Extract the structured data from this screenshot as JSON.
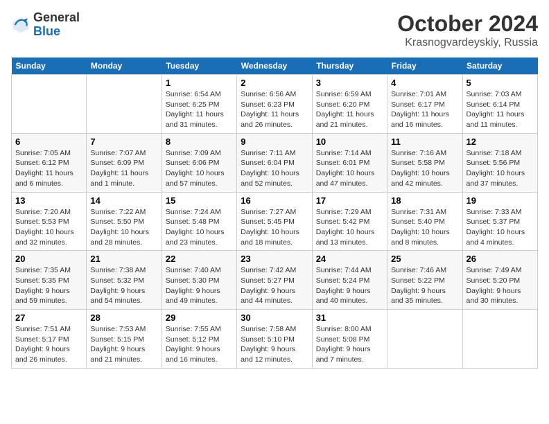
{
  "header": {
    "logo_line1": "General",
    "logo_line2": "Blue",
    "month": "October 2024",
    "location": "Krasnogvardeyskiy, Russia"
  },
  "weekdays": [
    "Sunday",
    "Monday",
    "Tuesday",
    "Wednesday",
    "Thursday",
    "Friday",
    "Saturday"
  ],
  "weeks": [
    [
      {
        "day": "",
        "info": ""
      },
      {
        "day": "",
        "info": ""
      },
      {
        "day": "1",
        "info": "Sunrise: 6:54 AM\nSunset: 6:25 PM\nDaylight: 11 hours\nand 31 minutes."
      },
      {
        "day": "2",
        "info": "Sunrise: 6:56 AM\nSunset: 6:23 PM\nDaylight: 11 hours\nand 26 minutes."
      },
      {
        "day": "3",
        "info": "Sunrise: 6:59 AM\nSunset: 6:20 PM\nDaylight: 11 hours\nand 21 minutes."
      },
      {
        "day": "4",
        "info": "Sunrise: 7:01 AM\nSunset: 6:17 PM\nDaylight: 11 hours\nand 16 minutes."
      },
      {
        "day": "5",
        "info": "Sunrise: 7:03 AM\nSunset: 6:14 PM\nDaylight: 11 hours\nand 11 minutes."
      }
    ],
    [
      {
        "day": "6",
        "info": "Sunrise: 7:05 AM\nSunset: 6:12 PM\nDaylight: 11 hours\nand 6 minutes."
      },
      {
        "day": "7",
        "info": "Sunrise: 7:07 AM\nSunset: 6:09 PM\nDaylight: 11 hours\nand 1 minute."
      },
      {
        "day": "8",
        "info": "Sunrise: 7:09 AM\nSunset: 6:06 PM\nDaylight: 10 hours\nand 57 minutes."
      },
      {
        "day": "9",
        "info": "Sunrise: 7:11 AM\nSunset: 6:04 PM\nDaylight: 10 hours\nand 52 minutes."
      },
      {
        "day": "10",
        "info": "Sunrise: 7:14 AM\nSunset: 6:01 PM\nDaylight: 10 hours\nand 47 minutes."
      },
      {
        "day": "11",
        "info": "Sunrise: 7:16 AM\nSunset: 5:58 PM\nDaylight: 10 hours\nand 42 minutes."
      },
      {
        "day": "12",
        "info": "Sunrise: 7:18 AM\nSunset: 5:56 PM\nDaylight: 10 hours\nand 37 minutes."
      }
    ],
    [
      {
        "day": "13",
        "info": "Sunrise: 7:20 AM\nSunset: 5:53 PM\nDaylight: 10 hours\nand 32 minutes."
      },
      {
        "day": "14",
        "info": "Sunrise: 7:22 AM\nSunset: 5:50 PM\nDaylight: 10 hours\nand 28 minutes."
      },
      {
        "day": "15",
        "info": "Sunrise: 7:24 AM\nSunset: 5:48 PM\nDaylight: 10 hours\nand 23 minutes."
      },
      {
        "day": "16",
        "info": "Sunrise: 7:27 AM\nSunset: 5:45 PM\nDaylight: 10 hours\nand 18 minutes."
      },
      {
        "day": "17",
        "info": "Sunrise: 7:29 AM\nSunset: 5:42 PM\nDaylight: 10 hours\nand 13 minutes."
      },
      {
        "day": "18",
        "info": "Sunrise: 7:31 AM\nSunset: 5:40 PM\nDaylight: 10 hours\nand 8 minutes."
      },
      {
        "day": "19",
        "info": "Sunrise: 7:33 AM\nSunset: 5:37 PM\nDaylight: 10 hours\nand 4 minutes."
      }
    ],
    [
      {
        "day": "20",
        "info": "Sunrise: 7:35 AM\nSunset: 5:35 PM\nDaylight: 9 hours\nand 59 minutes."
      },
      {
        "day": "21",
        "info": "Sunrise: 7:38 AM\nSunset: 5:32 PM\nDaylight: 9 hours\nand 54 minutes."
      },
      {
        "day": "22",
        "info": "Sunrise: 7:40 AM\nSunset: 5:30 PM\nDaylight: 9 hours\nand 49 minutes."
      },
      {
        "day": "23",
        "info": "Sunrise: 7:42 AM\nSunset: 5:27 PM\nDaylight: 9 hours\nand 44 minutes."
      },
      {
        "day": "24",
        "info": "Sunrise: 7:44 AM\nSunset: 5:24 PM\nDaylight: 9 hours\nand 40 minutes."
      },
      {
        "day": "25",
        "info": "Sunrise: 7:46 AM\nSunset: 5:22 PM\nDaylight: 9 hours\nand 35 minutes."
      },
      {
        "day": "26",
        "info": "Sunrise: 7:49 AM\nSunset: 5:20 PM\nDaylight: 9 hours\nand 30 minutes."
      }
    ],
    [
      {
        "day": "27",
        "info": "Sunrise: 7:51 AM\nSunset: 5:17 PM\nDaylight: 9 hours\nand 26 minutes."
      },
      {
        "day": "28",
        "info": "Sunrise: 7:53 AM\nSunset: 5:15 PM\nDaylight: 9 hours\nand 21 minutes."
      },
      {
        "day": "29",
        "info": "Sunrise: 7:55 AM\nSunset: 5:12 PM\nDaylight: 9 hours\nand 16 minutes."
      },
      {
        "day": "30",
        "info": "Sunrise: 7:58 AM\nSunset: 5:10 PM\nDaylight: 9 hours\nand 12 minutes."
      },
      {
        "day": "31",
        "info": "Sunrise: 8:00 AM\nSunset: 5:08 PM\nDaylight: 9 hours\nand 7 minutes."
      },
      {
        "day": "",
        "info": ""
      },
      {
        "day": "",
        "info": ""
      }
    ]
  ]
}
